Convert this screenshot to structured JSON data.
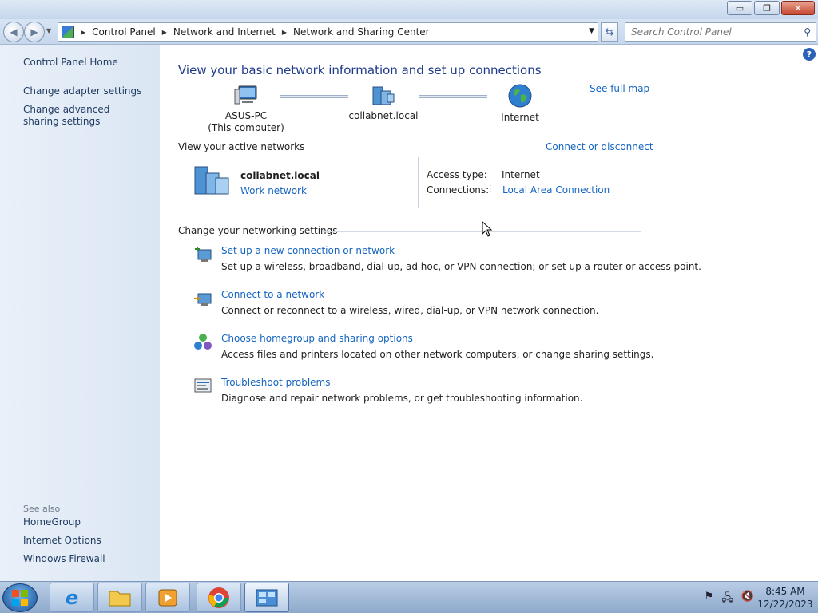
{
  "window": {
    "buttons": {
      "minimize": "▭",
      "restore": "❐",
      "close": "✕"
    }
  },
  "nav": {
    "breadcrumbs": [
      "Control Panel",
      "Network and Internet",
      "Network and Sharing Center"
    ],
    "search_placeholder": "Search Control Panel"
  },
  "sidebar": {
    "home": "Control Panel Home",
    "links": [
      "Change adapter settings",
      "Change advanced sharing settings"
    ],
    "see_also_label": "See also",
    "see_also": [
      "HomeGroup",
      "Internet Options",
      "Windows Firewall"
    ]
  },
  "main": {
    "heading": "View your basic network information and set up connections",
    "see_full_map": "See full map",
    "map": {
      "computer_name": "ASUS-PC",
      "computer_sub": "(This computer)",
      "network": "collabnet.local",
      "internet": "Internet"
    },
    "active_networks": {
      "label": "View your active networks",
      "connect_link": "Connect or disconnect",
      "name": "collabnet.local",
      "type": "Work network",
      "access_type_label": "Access type:",
      "access_type_value": "Internet",
      "connections_label": "Connections:",
      "connections_value": "Local Area Connection"
    },
    "settings": {
      "label": "Change your networking settings",
      "tasks": [
        {
          "title": "Set up a new connection or network",
          "desc": "Set up a wireless, broadband, dial-up, ad hoc, or VPN connection; or set up a router or access point."
        },
        {
          "title": "Connect to a network",
          "desc": "Connect or reconnect to a wireless, wired, dial-up, or VPN network connection."
        },
        {
          "title": "Choose homegroup and sharing options",
          "desc": "Access files and printers located on other network computers, or change sharing settings."
        },
        {
          "title": "Troubleshoot problems",
          "desc": "Diagnose and repair network problems, or get troubleshooting information."
        }
      ]
    }
  },
  "taskbar": {
    "time": "8:45 AM",
    "date": "12/22/2023"
  }
}
